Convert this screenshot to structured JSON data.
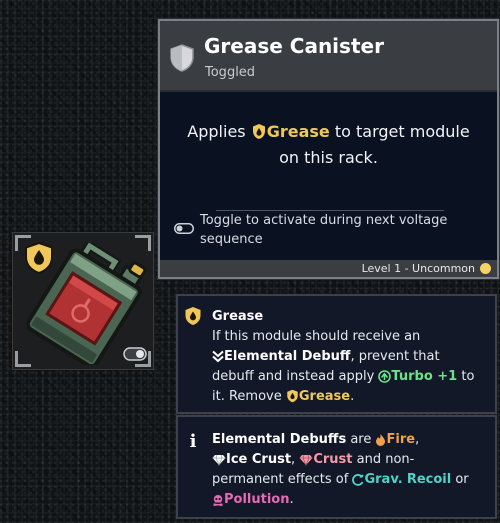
{
  "tooltip": {
    "title": "Grease Canister",
    "subtitle": "Toggled",
    "desc_prefix": "Applies",
    "desc_keyword": "Grease",
    "desc_suffix_1": "to target module",
    "desc_line2": "on this rack.",
    "toggle_text": "Toggle to activate during next voltage sequence",
    "footer_level": "Level 1 - Uncommon",
    "icons": {
      "header": "shield-icon",
      "keyword": "grease-drop-icon",
      "toggle": "toggle-switch-icon",
      "rarity": "rarity-dot-icon"
    }
  },
  "item": {
    "name": "Grease Canister",
    "icons": {
      "badge": "grease-drop-badge-icon",
      "art": "jerry-can-icon",
      "toggle": "toggle-switch-icon"
    }
  },
  "keywords": {
    "grease": {
      "title": "Grease",
      "line1": "If this module should receive an",
      "debuff_label": "Elemental Debuff",
      "line2b": ", prevent that",
      "line3a": "debuff and instead apply",
      "turbo_label": "Turbo +1",
      "line3b": " to",
      "line4a": "it. Remove",
      "grease_label": "Grease",
      "line4b": ".",
      "icons": {
        "title": "grease-drop-icon",
        "debuff": "double-chevron-down-icon",
        "turbo": "turbo-up-icon",
        "grease": "grease-drop-icon"
      }
    },
    "info": {
      "info_glyph": "i",
      "title": "Elemental Debuffs",
      "are": " are ",
      "fire": "Fire",
      "comma1": ",",
      "ice": "Ice Crust",
      "comma2": ", ",
      "crust": "Crust",
      "and_non": " and non-",
      "line3": "permanent effects of ",
      "grav": "Grav.",
      "recoil": "Recoil",
      "or": " or",
      "pollution": "Pollution",
      "period": ".",
      "icons": {
        "info": "info-icon",
        "fire": "fire-icon",
        "ice": "ice-gem-icon",
        "crust": "crust-gem-icon",
        "grav": "grav-swirl-icon",
        "pollution": "skull-icon"
      }
    }
  },
  "colors": {
    "keyword_gold": "#f0c85a",
    "turbo_green": "#6fe08a",
    "fire_orange": "#f2a04c",
    "crust_pink": "#f29aa8",
    "recoil_teal": "#4fd3c4",
    "pollution_magenta": "#e56ab5",
    "tooltip_bg": "#0a1221",
    "header_gray": "#3a3d42"
  }
}
